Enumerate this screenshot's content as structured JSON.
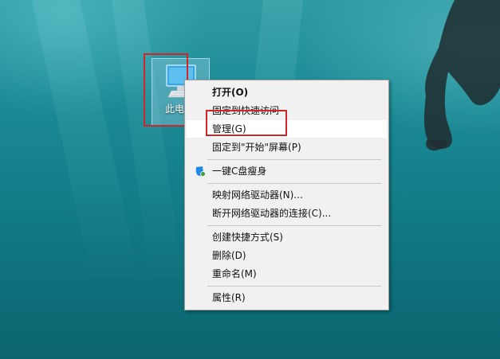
{
  "desktop": {
    "icon_label": "此电"
  },
  "context_menu": {
    "items": [
      {
        "label": "打开(O)",
        "bold": true
      },
      {
        "label": "固定到快速访问"
      },
      {
        "label": "管理(G)"
      },
      {
        "label": "固定到\"开始\"屏幕(P)"
      },
      {
        "label": "一键C盘瘦身",
        "icon": "shield-badge-icon"
      },
      {
        "label": "映射网络驱动器(N)..."
      },
      {
        "label": "断开网络驱动器的连接(C)..."
      },
      {
        "label": "创建快捷方式(S)"
      },
      {
        "label": "删除(D)"
      },
      {
        "label": "重命名(M)"
      },
      {
        "label": "属性(R)"
      }
    ]
  },
  "colors": {
    "highlight_box": "#d0262a",
    "menu_background": "#f1f1f1"
  }
}
